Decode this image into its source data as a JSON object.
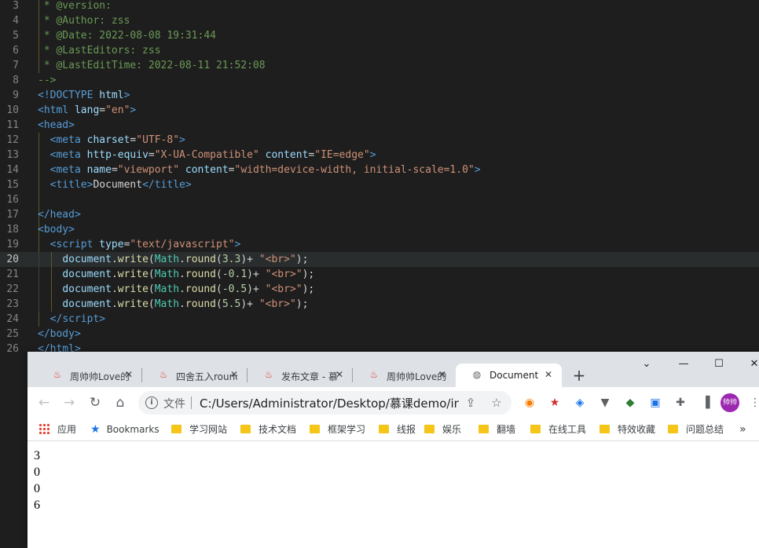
{
  "editor": {
    "lines": [
      {
        "n": "3",
        "parts": [
          [
            " * @version:",
            "cm"
          ]
        ]
      },
      {
        "n": "4",
        "parts": [
          [
            " * @Author: zss",
            "cm"
          ]
        ]
      },
      {
        "n": "5",
        "parts": [
          [
            " * @Date: 2022-08-08 19:31:44",
            "cm"
          ]
        ]
      },
      {
        "n": "6",
        "parts": [
          [
            " * @LastEditors: zss",
            "cm"
          ]
        ]
      },
      {
        "n": "7",
        "parts": [
          [
            " * @LastEditTime: 2022-08-11 21:52:08",
            "cm"
          ]
        ]
      },
      {
        "n": "8",
        "parts": [
          [
            "-->",
            "cm"
          ]
        ]
      },
      {
        "n": "9",
        "parts": [
          [
            "<!",
            "tag"
          ],
          [
            "DOCTYPE",
            "tag"
          ],
          [
            " ",
            "txt"
          ],
          [
            "html",
            "attr"
          ],
          [
            ">",
            "tag"
          ]
        ]
      },
      {
        "n": "10",
        "parts": [
          [
            "<",
            "tag"
          ],
          [
            "html",
            "tag"
          ],
          [
            " ",
            "txt"
          ],
          [
            "lang",
            "attr"
          ],
          [
            "=",
            "txt"
          ],
          [
            "\"en\"",
            "str"
          ],
          [
            ">",
            "tag"
          ]
        ]
      },
      {
        "n": "11",
        "parts": [
          [
            "<",
            "tag"
          ],
          [
            "head",
            "tag"
          ],
          [
            ">",
            "tag"
          ]
        ]
      },
      {
        "n": "12",
        "parts": [
          [
            "  <",
            "tag"
          ],
          [
            "meta",
            "tag"
          ],
          [
            " ",
            "txt"
          ],
          [
            "charset",
            "attr"
          ],
          [
            "=",
            "txt"
          ],
          [
            "\"UTF-8\"",
            "str"
          ],
          [
            ">",
            "tag"
          ]
        ]
      },
      {
        "n": "13",
        "parts": [
          [
            "  <",
            "tag"
          ],
          [
            "meta",
            "tag"
          ],
          [
            " ",
            "txt"
          ],
          [
            "http-equiv",
            "attr"
          ],
          [
            "=",
            "txt"
          ],
          [
            "\"X-UA-Compatible\"",
            "str"
          ],
          [
            " ",
            "txt"
          ],
          [
            "content",
            "attr"
          ],
          [
            "=",
            "txt"
          ],
          [
            "\"IE=edge\"",
            "str"
          ],
          [
            ">",
            "tag"
          ]
        ]
      },
      {
        "n": "14",
        "parts": [
          [
            "  <",
            "tag"
          ],
          [
            "meta",
            "tag"
          ],
          [
            " ",
            "txt"
          ],
          [
            "name",
            "attr"
          ],
          [
            "=",
            "txt"
          ],
          [
            "\"viewport\"",
            "str"
          ],
          [
            " ",
            "txt"
          ],
          [
            "content",
            "attr"
          ],
          [
            "=",
            "txt"
          ],
          [
            "\"width=device-width, initial-scale=1.0\"",
            "str"
          ],
          [
            ">",
            "tag"
          ]
        ]
      },
      {
        "n": "15",
        "parts": [
          [
            "  <",
            "tag"
          ],
          [
            "title",
            "tag"
          ],
          [
            ">",
            "tag"
          ],
          [
            "Document",
            "txt"
          ],
          [
            "</",
            "tag"
          ],
          [
            "title",
            "tag"
          ],
          [
            ">",
            "tag"
          ]
        ]
      },
      {
        "n": "16",
        "parts": []
      },
      {
        "n": "17",
        "parts": [
          [
            "</",
            "tag"
          ],
          [
            "head",
            "tag"
          ],
          [
            ">",
            "tag"
          ]
        ]
      },
      {
        "n": "18",
        "parts": [
          [
            "<",
            "tag"
          ],
          [
            "body",
            "tag"
          ],
          [
            ">",
            "tag"
          ]
        ]
      },
      {
        "n": "19",
        "parts": [
          [
            "  <",
            "tag"
          ],
          [
            "script",
            "tag"
          ],
          [
            " ",
            "txt"
          ],
          [
            "type",
            "attr"
          ],
          [
            "=",
            "txt"
          ],
          [
            "\"text/javascript\"",
            "str"
          ],
          [
            ">",
            "tag"
          ]
        ]
      },
      {
        "n": "20",
        "parts": [
          [
            "    ",
            "txt"
          ],
          [
            "document",
            "var"
          ],
          [
            ".",
            "txt"
          ],
          [
            "write",
            "fn"
          ],
          [
            "(",
            "txt"
          ],
          [
            "Math",
            "obj"
          ],
          [
            ".",
            "txt"
          ],
          [
            "round",
            "fn"
          ],
          [
            "(",
            "txt"
          ],
          [
            "3.3",
            "num"
          ],
          [
            ")+ ",
            "txt"
          ],
          [
            "\"<br>\"",
            "str"
          ],
          [
            ");",
            "txt"
          ]
        ]
      },
      {
        "n": "21",
        "parts": [
          [
            "    ",
            "txt"
          ],
          [
            "document",
            "var"
          ],
          [
            ".",
            "txt"
          ],
          [
            "write",
            "fn"
          ],
          [
            "(",
            "txt"
          ],
          [
            "Math",
            "obj"
          ],
          [
            ".",
            "txt"
          ],
          [
            "round",
            "fn"
          ],
          [
            "(",
            "txt"
          ],
          [
            "-0.1",
            "num"
          ],
          [
            ")+ ",
            "txt"
          ],
          [
            "\"<br>\"",
            "str"
          ],
          [
            ");",
            "txt"
          ]
        ]
      },
      {
        "n": "22",
        "parts": [
          [
            "    ",
            "txt"
          ],
          [
            "document",
            "var"
          ],
          [
            ".",
            "txt"
          ],
          [
            "write",
            "fn"
          ],
          [
            "(",
            "txt"
          ],
          [
            "Math",
            "obj"
          ],
          [
            ".",
            "txt"
          ],
          [
            "round",
            "fn"
          ],
          [
            "(",
            "txt"
          ],
          [
            "-0.5",
            "num"
          ],
          [
            ")+ ",
            "txt"
          ],
          [
            "\"<br>\"",
            "str"
          ],
          [
            ");",
            "txt"
          ]
        ]
      },
      {
        "n": "23",
        "parts": [
          [
            "    ",
            "txt"
          ],
          [
            "document",
            "var"
          ],
          [
            ".",
            "txt"
          ],
          [
            "write",
            "fn"
          ],
          [
            "(",
            "txt"
          ],
          [
            "Math",
            "obj"
          ],
          [
            ".",
            "txt"
          ],
          [
            "round",
            "fn"
          ],
          [
            "(",
            "txt"
          ],
          [
            "5.5",
            "num"
          ],
          [
            ")+ ",
            "txt"
          ],
          [
            "\"<br>\"",
            "str"
          ],
          [
            ");",
            "txt"
          ]
        ]
      },
      {
        "n": "24",
        "parts": [
          [
            "  </",
            "tag"
          ],
          [
            "script",
            "tag"
          ],
          [
            ">",
            "tag"
          ]
        ]
      },
      {
        "n": "25",
        "parts": [
          [
            "</",
            "tag"
          ],
          [
            "body",
            "tag"
          ],
          [
            ">",
            "tag"
          ]
        ]
      },
      {
        "n": "26",
        "parts": [
          [
            "</",
            "tag"
          ],
          [
            "html",
            "tag"
          ],
          [
            ">",
            "tag"
          ]
        ]
      }
    ],
    "active_line": "20",
    "colors": {
      "cm": "#6a9955",
      "tag": "#569cd6",
      "attr": "#9cdcfe",
      "str": "#ce9178",
      "txt": "#d4d4d4",
      "fn": "#dcdcaa",
      "obj": "#4ec9b0",
      "num": "#b5cea8",
      "var": "#9cdcfe"
    }
  },
  "browser": {
    "tabs": [
      {
        "label": "周帅帅Love的",
        "icon": "flame-icon",
        "active": false
      },
      {
        "label": "四舍五入round",
        "icon": "flame-icon",
        "active": false
      },
      {
        "label": "发布文章 - 慕",
        "icon": "flame-icon",
        "active": false
      },
      {
        "label": "周帅帅Love的",
        "icon": "flame-icon",
        "active": false
      },
      {
        "label": "Document",
        "icon": "globe-icon",
        "active": true
      }
    ],
    "new_tab": "+",
    "window_controls": {
      "tab_search": "⌄",
      "minimize": "—",
      "maximize": "☐",
      "close": "✕"
    },
    "nav": {
      "back": "←",
      "forward": "→",
      "reload": "↻",
      "home": "⌂"
    },
    "omnibox": {
      "security_label": "文件",
      "url": "C:/Users/Administrator/Desktop/慕课demo/ind..."
    },
    "avatar_text": "帅帅",
    "bookmarks": [
      {
        "label": "应用",
        "icon": "apps-grid-icon"
      },
      {
        "label": "Bookmarks",
        "icon": "star-icon"
      },
      {
        "label": "学习网站",
        "icon": "folder-icon"
      },
      {
        "label": "技术文档",
        "icon": "folder-icon"
      },
      {
        "label": "框架学习",
        "icon": "folder-icon"
      },
      {
        "label": "线报",
        "icon": "folder-icon"
      },
      {
        "label": "娱乐",
        "icon": "folder-icon"
      },
      {
        "label": "翻墙",
        "icon": "folder-icon"
      },
      {
        "label": "在线工具",
        "icon": "folder-icon"
      },
      {
        "label": "特效收藏",
        "icon": "folder-icon"
      },
      {
        "label": "问题总结",
        "icon": "folder-icon"
      }
    ],
    "bookmarks_overflow": "»",
    "output": [
      "3",
      "0",
      "0",
      "6"
    ]
  }
}
